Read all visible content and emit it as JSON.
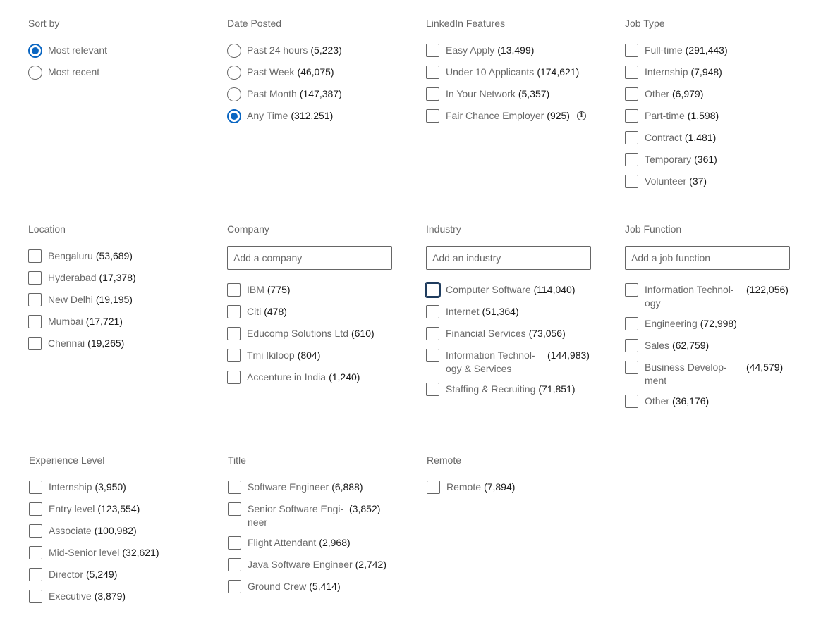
{
  "sort_by": {
    "heading": "Sort by",
    "options": [
      {
        "label": "Most relevant",
        "checked": true
      },
      {
        "label": "Most recent",
        "checked": false
      }
    ]
  },
  "date_posted": {
    "heading": "Date Posted",
    "options": [
      {
        "label": "Past 24 hours",
        "count": "(5,223)",
        "checked": false
      },
      {
        "label": "Past Week",
        "count": "(46,075)",
        "checked": false
      },
      {
        "label": "Past Month",
        "count": "(147,387)",
        "checked": false
      },
      {
        "label": "Any Time",
        "count": "(312,251)",
        "checked": true
      }
    ]
  },
  "linkedin_features": {
    "heading": "LinkedIn Features",
    "options": [
      {
        "label": "Easy Apply",
        "count": "(13,499)"
      },
      {
        "label": "Under 10 Applicants",
        "count": "(174,621)"
      },
      {
        "label": "In Your Network",
        "count": "(5,357)"
      },
      {
        "label": "Fair Chance Employer",
        "count": "(925)",
        "info_icon": "info-icon",
        "info_glyph": "i"
      }
    ]
  },
  "job_type": {
    "heading": "Job Type",
    "options": [
      {
        "label": "Full-time",
        "count": "(291,443)"
      },
      {
        "label": "Internship",
        "count": "(7,948)"
      },
      {
        "label": "Other",
        "count": "(6,979)"
      },
      {
        "label": "Part-time",
        "count": "(1,598)"
      },
      {
        "label": "Contract",
        "count": "(1,481)"
      },
      {
        "label": "Temporary",
        "count": "(361)"
      },
      {
        "label": "Volunteer",
        "count": "(37)"
      }
    ]
  },
  "location": {
    "heading": "Location",
    "options": [
      {
        "label": "Bengaluru",
        "count": "(53,689)"
      },
      {
        "label": "Hyderabad",
        "count": "(17,378)"
      },
      {
        "label": "New Delhi",
        "count": "(19,195)"
      },
      {
        "label": "Mumbai",
        "count": "(17,721)"
      },
      {
        "label": "Chennai",
        "count": "(19,265)"
      }
    ]
  },
  "company": {
    "heading": "Company",
    "placeholder": "Add a company",
    "options": [
      {
        "label": "IBM",
        "count": "(775)"
      },
      {
        "label": "Citi",
        "count": "(478)"
      },
      {
        "label": "Educomp Solutions Ltd",
        "count": "(610)"
      },
      {
        "label": "Tmi Ikiloop",
        "count": "(804)"
      },
      {
        "label": "Accenture in India",
        "count": "(1,240)"
      }
    ]
  },
  "industry": {
    "heading": "Industry",
    "placeholder": "Add an industry",
    "options": [
      {
        "label": "Computer Software",
        "count": "(114,040)",
        "focused": true
      },
      {
        "label": "Internet",
        "count": "(51,364)"
      },
      {
        "label": "Financial Services",
        "count": "(73,056)"
      },
      {
        "label": "Information Technol-ogy & Services",
        "label_lines": [
          "Information Technol-",
          "ogy & Services"
        ],
        "count": "(144,983)"
      },
      {
        "label": "Staffing & Recruiting",
        "count": "(71,851)"
      }
    ]
  },
  "job_function": {
    "heading": "Job Function",
    "placeholder": "Add a job function",
    "options": [
      {
        "label": "Information Technol-ogy",
        "label_lines": [
          "Information Technol-",
          "ogy"
        ],
        "count": "(122,056)"
      },
      {
        "label": "Engineering",
        "count": "(72,998)"
      },
      {
        "label": "Sales",
        "count": "(62,759)"
      },
      {
        "label": "Business Develop-ment",
        "label_lines": [
          "Business Develop-",
          "ment"
        ],
        "count": "(44,579)"
      },
      {
        "label": "Other",
        "count": "(36,176)"
      }
    ]
  },
  "experience_level": {
    "heading": "Experience Level",
    "options": [
      {
        "label": "Internship",
        "count": "(3,950)"
      },
      {
        "label": "Entry level",
        "count": "(123,554)"
      },
      {
        "label": "Associate",
        "count": "(100,982)"
      },
      {
        "label": "Mid-Senior level",
        "count": "(32,621)"
      },
      {
        "label": "Director",
        "count": "(5,249)"
      },
      {
        "label": "Executive",
        "count": "(3,879)"
      }
    ]
  },
  "title": {
    "heading": "Title",
    "options": [
      {
        "label": "Software Engineer",
        "count": "(6,888)"
      },
      {
        "label": "Senior Software Engi-neer",
        "label_lines": [
          "Senior Software Engi-",
          "neer"
        ],
        "count": "(3,852)"
      },
      {
        "label": "Flight Attendant",
        "count": "(2,968)"
      },
      {
        "label": "Java Software Engineer",
        "count": "(2,742)"
      },
      {
        "label": "Ground Crew",
        "count": "(5,414)"
      }
    ]
  },
  "remote": {
    "heading": "Remote",
    "options": [
      {
        "label": "Remote",
        "count": "(7,894)"
      }
    ]
  },
  "colors": {
    "accent": "#0a66c2",
    "focus": "#1f3c5e"
  }
}
